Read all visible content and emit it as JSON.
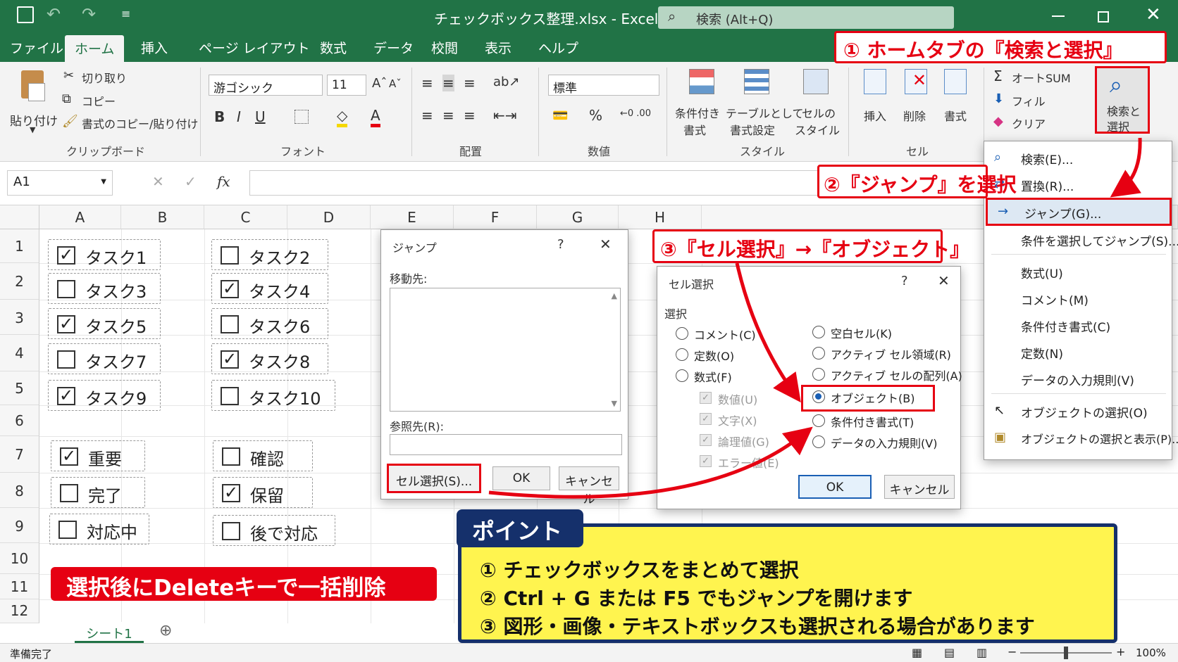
{
  "titlebar": {
    "title": "チェックボックス整理.xlsx - Excel",
    "search": "検索 (Alt+Q)"
  },
  "tabs": [
    "ファイル",
    "ホーム",
    "挿入",
    "ページ レイアウト",
    "数式",
    "データ",
    "校閲",
    "表示",
    "ヘルプ"
  ],
  "ribbon": {
    "paste": "貼り付け",
    "cut": "切り取り",
    "copy": "コピー",
    "format_painter": "書式のコピー/貼り付け",
    "clipboard": "クリップボード",
    "font_name": "游ゴシック",
    "font_size": "11",
    "font": "フォント",
    "alignment": "配置",
    "number_format": "標準",
    "number": "数値",
    "cond_format_1": "条件付き",
    "cond_format_2": "書式",
    "table_format_1": "テーブルとして",
    "table_format_2": "書式設定",
    "cell_style_1": "セルの",
    "cell_style_2": "スタイル",
    "styles": "スタイル",
    "insert": "挿入",
    "delete": "削除",
    "format": "書式",
    "cells": "セル",
    "autosum": "オートSUM",
    "fill": "フィル",
    "clear": "クリア",
    "find_select_1": "検索と",
    "find_select_2": "選択"
  },
  "formula_bar": {
    "namebox": "A1",
    "fx": "fx"
  },
  "columns": [
    "A",
    "B",
    "C",
    "D",
    "E",
    "F",
    "G",
    "H"
  ],
  "rows": [
    "1",
    "2",
    "3",
    "4",
    "5",
    "6",
    "7",
    "8",
    "9",
    "10",
    "11",
    "12"
  ],
  "checkboxes": [
    {
      "label": "タスク1",
      "checked": "✓"
    },
    {
      "label": "タスク2",
      "checked": ""
    },
    {
      "label": "タスク3",
      "checked": ""
    },
    {
      "label": "タスク4",
      "checked": "✓"
    },
    {
      "label": "タスク5",
      "checked": "✓"
    },
    {
      "label": "タスク6",
      "checked": ""
    },
    {
      "label": "タスク7",
      "checked": ""
    },
    {
      "label": "タスク8",
      "checked": "✓"
    },
    {
      "label": "タスク9",
      "checked": "✓"
    },
    {
      "label": "タスク10",
      "checked": ""
    },
    {
      "label": "重要",
      "checked": "✓"
    },
    {
      "label": "確認",
      "checked": ""
    },
    {
      "label": "完了",
      "checked": ""
    },
    {
      "label": "保留",
      "checked": "✓"
    },
    {
      "label": "対応中",
      "checked": ""
    },
    {
      "label": "後で対応",
      "checked": ""
    }
  ],
  "jump_dialog": {
    "title": "ジャンプ",
    "help": "?",
    "goto_label": "移動先:",
    "ref_label": "参照先(R):",
    "special_button": "セル選択(S)...",
    "ok": "OK",
    "cancel": "キャンセル"
  },
  "special_dialog": {
    "title": "セル選択",
    "help": "?",
    "group": "選択",
    "left": [
      "コメント(C)",
      "定数(O)",
      "数式(F)"
    ],
    "sub": [
      "数値(U)",
      "文字(X)",
      "論理値(G)",
      "エラー値(E)"
    ],
    "right": [
      "空白セル(K)",
      "アクティブ セル領域(R)",
      "アクティブ セルの配列(A)",
      "オブジェクト(B)",
      "条件付き書式(T)",
      "データの入力規則(V)"
    ],
    "ok": "OK",
    "cancel": "キャンセル"
  },
  "dropdown": [
    "検索(E)...",
    "置換(R)...",
    "ジャンプ(G)...",
    "条件を選択してジャンプ(S)...",
    "数式(U)",
    "コメント(M)",
    "条件付き書式(C)",
    "定数(N)",
    "データの入力規則(V)",
    "オブジェクトの選択(O)",
    "オブジェクトの選択と表示(P)..."
  ],
  "callouts": {
    "c1": "① ホームタブの『検索と選択』",
    "c2": "②『ジャンプ』を選択",
    "c3": "③『セル選択』→『オブジェクト』",
    "delete_note": "選択後にDeleteキーで一括削除"
  },
  "point": {
    "title": "ポイント",
    "lines": [
      "① チェックボックスをまとめて選択",
      "② Ctrl + G または F5 でもジャンプを開けます",
      "③ 図形・画像・テキストボックスも選択される場合があります"
    ]
  },
  "sheet_tab": "シート1",
  "status": {
    "ready": "準備完了",
    "zoom": "100%"
  },
  "colors": {
    "excel_green": "#217346",
    "accent_red": "#e60012",
    "point_yellow": "#fff44f",
    "point_navy": "#15306b"
  }
}
